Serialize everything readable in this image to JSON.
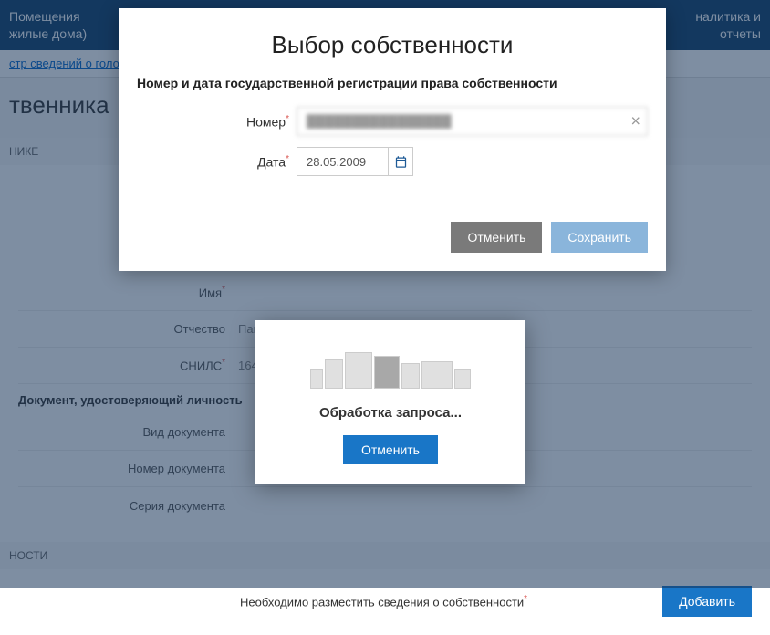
{
  "nav": {
    "left_line1": "Помещения",
    "left_line2": "жилые дома)",
    "right_line1": "налитика и",
    "right_line2": "отчеты"
  },
  "breadcrumb": "стр сведений о голо",
  "page_title": "твенника",
  "section_person": "НИКЕ",
  "form": {
    "name_label": "Имя",
    "patronymic_label": "Отчество",
    "patronymic_value": "Пав",
    "snils_label": "СНИЛС",
    "snils_value": "164-",
    "doc_heading": "Документ, удостоверяющий личность",
    "doc_type_label": "Вид документа",
    "doc_number_label": "Номер документа",
    "doc_series_label": "Серия документа"
  },
  "section_owner": "НОСТИ",
  "bottom_notice": "Необходимо разместить сведения о собственности",
  "add_button": "Добавить",
  "modal": {
    "title": "Выбор собственности",
    "subtitle": "Номер и дата государственной регистрации права собственности",
    "number_label": "Номер",
    "number_value": "████████████████",
    "date_label": "Дата",
    "date_value": "28.05.2009",
    "cancel": "Отменить",
    "save": "Сохранить"
  },
  "loading": {
    "text": "Обработка запроса...",
    "cancel": "Отменить"
  }
}
